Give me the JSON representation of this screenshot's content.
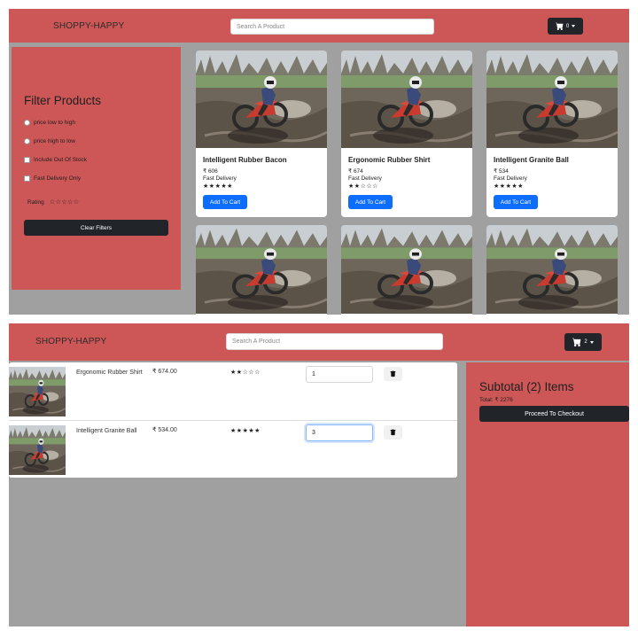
{
  "store": {
    "brand": "SHOPPY-HAPPY",
    "search_placeholder": "Search A Product"
  },
  "colors": {
    "primary_red": "#cd5656",
    "dark_button": "#212529",
    "blue_button": "#0d6efd",
    "panel_gray": "#a0a0a0"
  },
  "icons": {
    "cart": "shopping-cart-icon",
    "delete": "trash-icon",
    "dropdown": "caret-down-icon",
    "star": "star-icon"
  },
  "listing_page": {
    "cart_count": "0",
    "filters": {
      "title": "Filter Products",
      "options": [
        {
          "label": "price low to high",
          "type": "radio"
        },
        {
          "label": "price high to low",
          "type": "radio"
        },
        {
          "label": "Include Out Of Stock",
          "type": "checkbox"
        },
        {
          "label": "Fast Delivery Only",
          "type": "checkbox"
        }
      ],
      "rating_label": "Rating",
      "rating_value": 0,
      "clear_label": "Clear Filters"
    },
    "products": [
      {
        "name": "Intelligent Rubber Bacon",
        "price": "₹ 606",
        "delivery": "Fast Delivery",
        "rating": 5,
        "button": "Add To Cart"
      },
      {
        "name": "Ergonomic Rubber Shirt",
        "price": "₹ 674",
        "delivery": "Fast Delivery",
        "rating": 2,
        "button": "Add To Cart"
      },
      {
        "name": "Intelligent Granite Ball",
        "price": "₹ 534",
        "delivery": "Fast Delivery",
        "rating": 5,
        "button": "Add To Cart"
      }
    ]
  },
  "cart_page": {
    "cart_count": "2",
    "items": [
      {
        "name": "Ergonomic Rubber Shirt",
        "price": "₹ 674.00",
        "rating": 2,
        "quantity": "1"
      },
      {
        "name": "Intelligent Granite Ball",
        "price": "₹ 534.00",
        "rating": 5,
        "quantity": "3"
      }
    ],
    "summary": {
      "title": "Subtotal (2) Items",
      "total": "Total: ₹ 2276",
      "checkout_label": "Proceed To Checkout"
    }
  }
}
